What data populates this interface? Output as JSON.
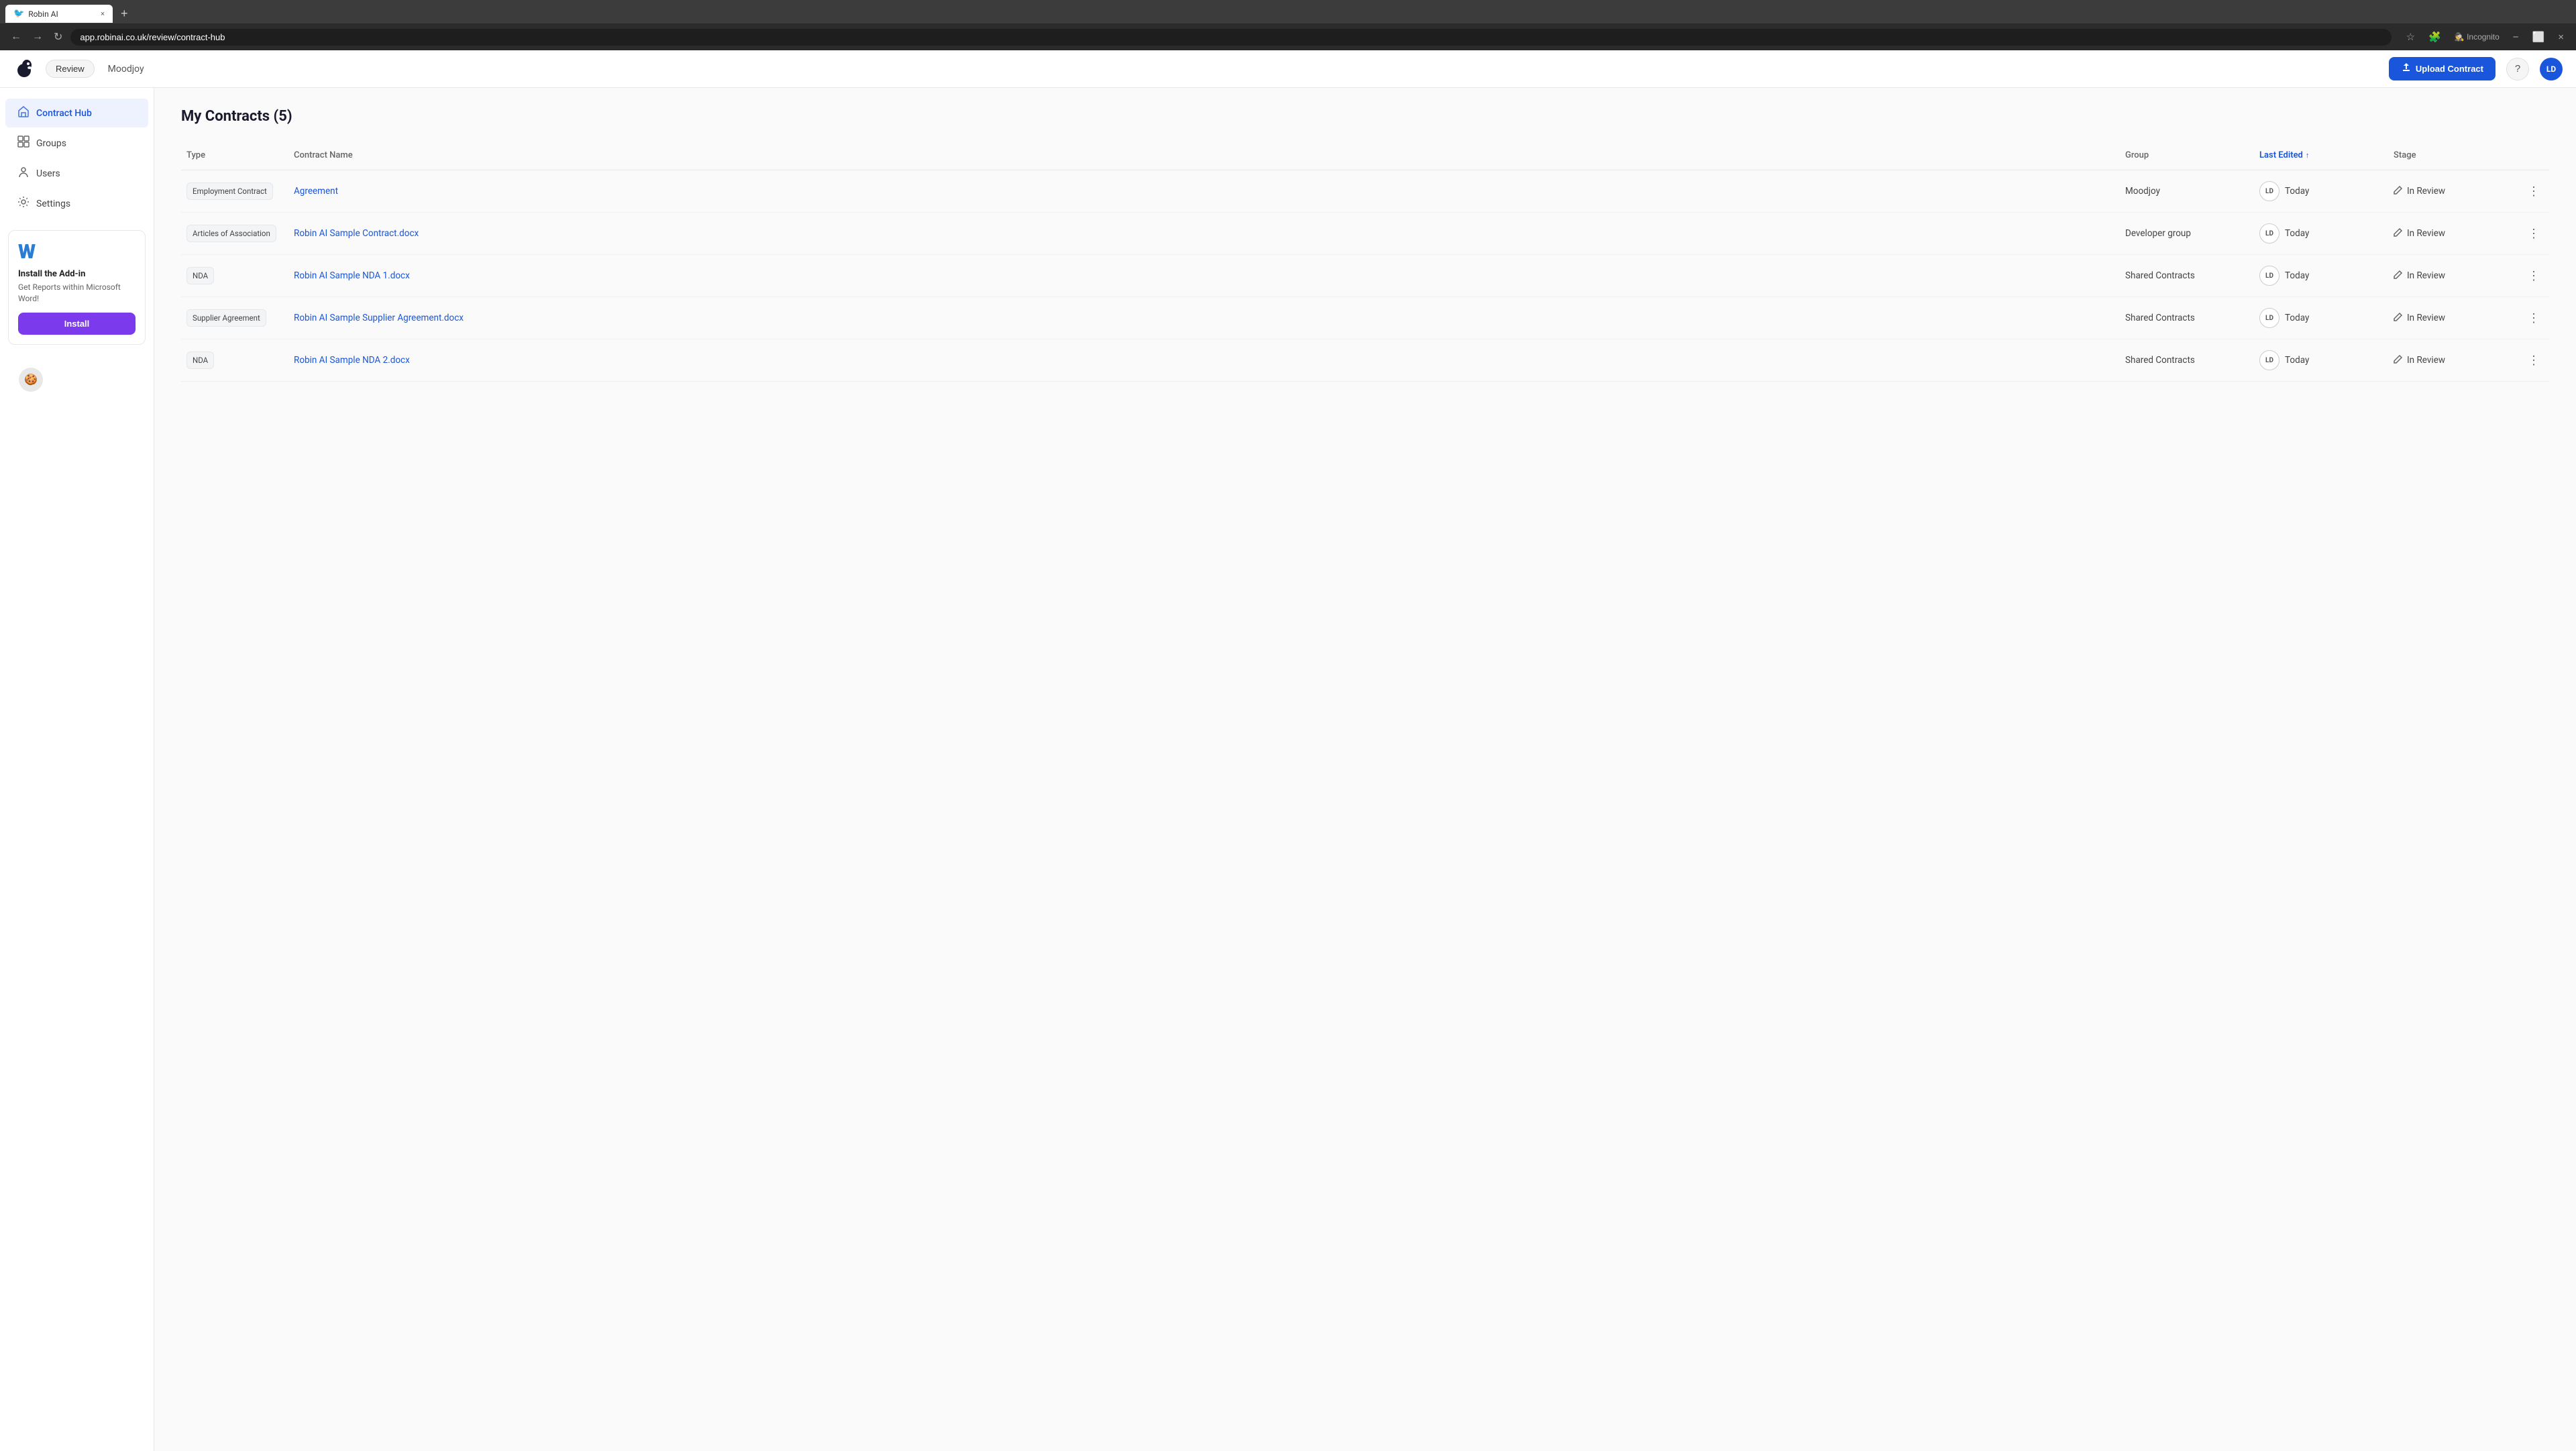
{
  "browser": {
    "tab_icon": "🐦",
    "tab_title": "Robin AI",
    "tab_close": "×",
    "new_tab": "+",
    "back": "←",
    "forward": "→",
    "refresh": "↻",
    "url": "app.robinai.co.uk/review/contract-hub",
    "star_icon": "☆",
    "extensions_icon": "🧩",
    "incognito_label": "Incognito",
    "minimize": "−",
    "maximize": "⬜",
    "close": "×"
  },
  "header": {
    "review_label": "Review",
    "company_name": "Moodjoy",
    "upload_btn_label": "Upload Contract",
    "upload_icon": "↑",
    "help_icon": "?",
    "avatar_initials": "LD"
  },
  "sidebar": {
    "items": [
      {
        "id": "contract-hub",
        "label": "Contract Hub",
        "icon": "🏠",
        "active": true
      },
      {
        "id": "groups",
        "label": "Groups",
        "icon": "⊞",
        "active": false
      },
      {
        "id": "users",
        "label": "Users",
        "icon": "👤",
        "active": false
      },
      {
        "id": "settings",
        "label": "Settings",
        "icon": "⚙",
        "active": false
      }
    ],
    "addon": {
      "word_icon": "W",
      "title": "Install the Add-in",
      "description": "Get Reports within Microsoft Word!",
      "install_btn": "Install"
    },
    "cookie_icon": "🍪"
  },
  "main": {
    "page_title": "My Contracts (5)",
    "table": {
      "columns": [
        {
          "id": "type",
          "label": "Type",
          "sorted": false
        },
        {
          "id": "name",
          "label": "Contract Name",
          "sorted": false
        },
        {
          "id": "group",
          "label": "Group",
          "sorted": false
        },
        {
          "id": "last_edited",
          "label": "Last Edited",
          "sorted": true
        },
        {
          "id": "stage",
          "label": "Stage",
          "sorted": false
        }
      ],
      "rows": [
        {
          "type": "Employment Contract",
          "name": "Agreement",
          "group": "Moodjoy",
          "avatar": "LD",
          "last_edited": "Today",
          "stage": "In Review"
        },
        {
          "type": "Articles of Association",
          "name": "Robin AI Sample Contract.docx",
          "group": "Developer group",
          "avatar": "LD",
          "last_edited": "Today",
          "stage": "In Review"
        },
        {
          "type": "NDA",
          "name": "Robin AI Sample NDA 1.docx",
          "group": "Shared Contracts",
          "avatar": "LD",
          "last_edited": "Today",
          "stage": "In Review"
        },
        {
          "type": "Supplier Agreement",
          "name": "Robin AI Sample Supplier Agreement.docx",
          "group": "Shared Contracts",
          "avatar": "LD",
          "last_edited": "Today",
          "stage": "In Review"
        },
        {
          "type": "NDA",
          "name": "Robin AI Sample NDA 2.docx",
          "group": "Shared Contracts",
          "avatar": "LD",
          "last_edited": "Today",
          "stage": "In Review"
        }
      ]
    }
  }
}
